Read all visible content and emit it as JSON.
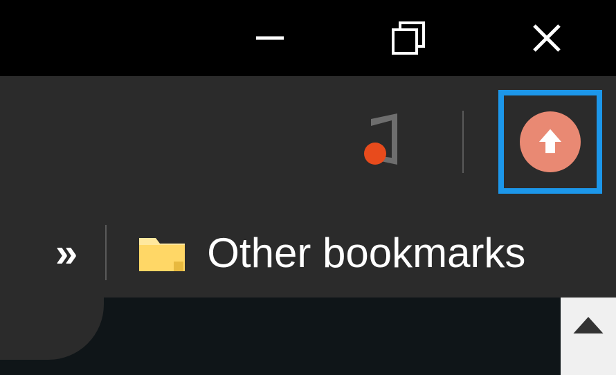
{
  "titlebar": {
    "minimize_icon": "minimize-icon",
    "restore_icon": "restore-icon",
    "close_icon": "close-icon"
  },
  "toolbar": {
    "extension": "office-extension",
    "upload_icon": "upload-icon"
  },
  "bookmarks": {
    "overflow": "»",
    "other_bookmarks_label": "Other bookmarks"
  },
  "scroll": {
    "up_icon": "scroll-up-icon"
  }
}
